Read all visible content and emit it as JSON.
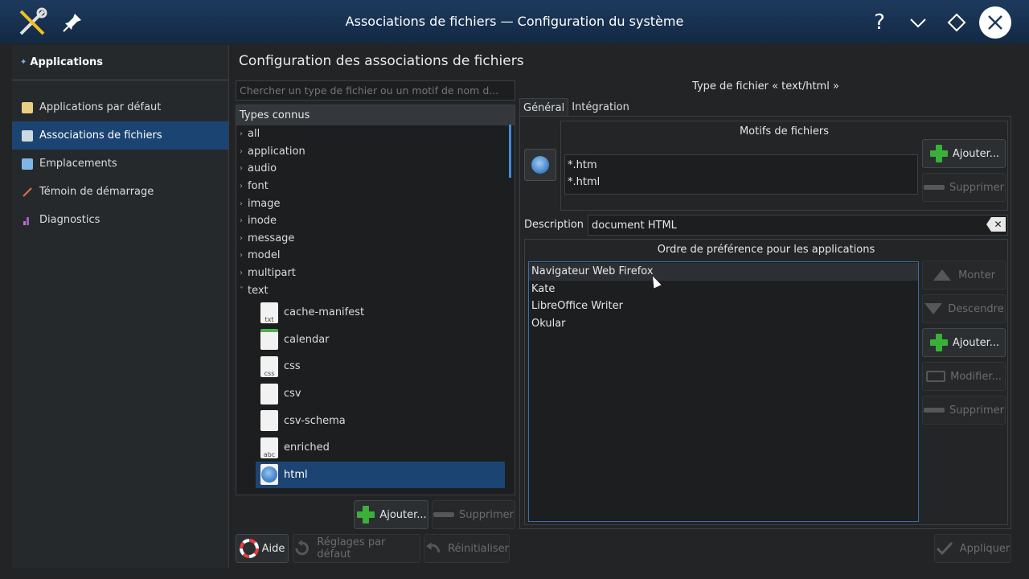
{
  "window": {
    "title": "Associations de fichiers — Configuration du système"
  },
  "titlebar": {
    "help_symbol": "?",
    "minimize_symbol": "⌄",
    "maximize_symbol": "◇",
    "close_symbol": "✕"
  },
  "sidebar": {
    "header": "Applications",
    "items": [
      {
        "label": "Applications par défaut",
        "icon": "star-doc-icon"
      },
      {
        "label": "Associations de fichiers",
        "icon": "file-assoc-icon"
      },
      {
        "label": "Emplacements",
        "icon": "folder-icon"
      },
      {
        "label": "Témoin de démarrage",
        "icon": "launch-feedback-icon"
      },
      {
        "label": "Diagnostics",
        "icon": "diagnostics-icon"
      }
    ]
  },
  "main": {
    "title": "Configuration des associations de fichiers",
    "search_placeholder": "Chercher un type de fichier ou un motif de nom d...",
    "tree_header": "Types connus",
    "tree_nodes": [
      "all",
      "application",
      "audio",
      "font",
      "image",
      "inode",
      "message",
      "model",
      "multipart",
      "text"
    ],
    "text_children": [
      {
        "label": "cache-manifest",
        "icon_text": "txt"
      },
      {
        "label": "calendar",
        "icon_text": ""
      },
      {
        "label": "css",
        "icon_text": "css"
      },
      {
        "label": "csv",
        "icon_text": ""
      },
      {
        "label": "csv-schema",
        "icon_text": ""
      },
      {
        "label": "enriched",
        "icon_text": "abc"
      },
      {
        "label": "html",
        "icon_text": ""
      }
    ],
    "add_button": "Ajouter...",
    "remove_button": "Supprimer"
  },
  "details": {
    "type_label": "Type de fichier « text/html »",
    "tabs": [
      "Général",
      "Intégration"
    ],
    "patterns_title": "Motifs de fichiers",
    "patterns": [
      "*.htm",
      "*.html"
    ],
    "patterns_add": "Ajouter...",
    "patterns_remove": "Supprimer",
    "description_label": "Description :",
    "description_value": "document HTML",
    "order_title": "Ordre de préférence pour les applications",
    "apps": [
      "Navigateur Web Firefox",
      "Kate",
      "LibreOffice Writer",
      "Okular"
    ],
    "buttons": {
      "up": "Monter",
      "down": "Descendre",
      "add": "Ajouter...",
      "edit": "Modifier...",
      "remove": "Supprimer"
    }
  },
  "footer": {
    "help": "Aide",
    "defaults": "Réglages par défaut",
    "reset": "Réinitialiser",
    "apply": "Appliquer"
  },
  "colors": {
    "accent": "#1b4472",
    "titlebar": "#1d3a5e",
    "add_green": "#3ab03a"
  }
}
